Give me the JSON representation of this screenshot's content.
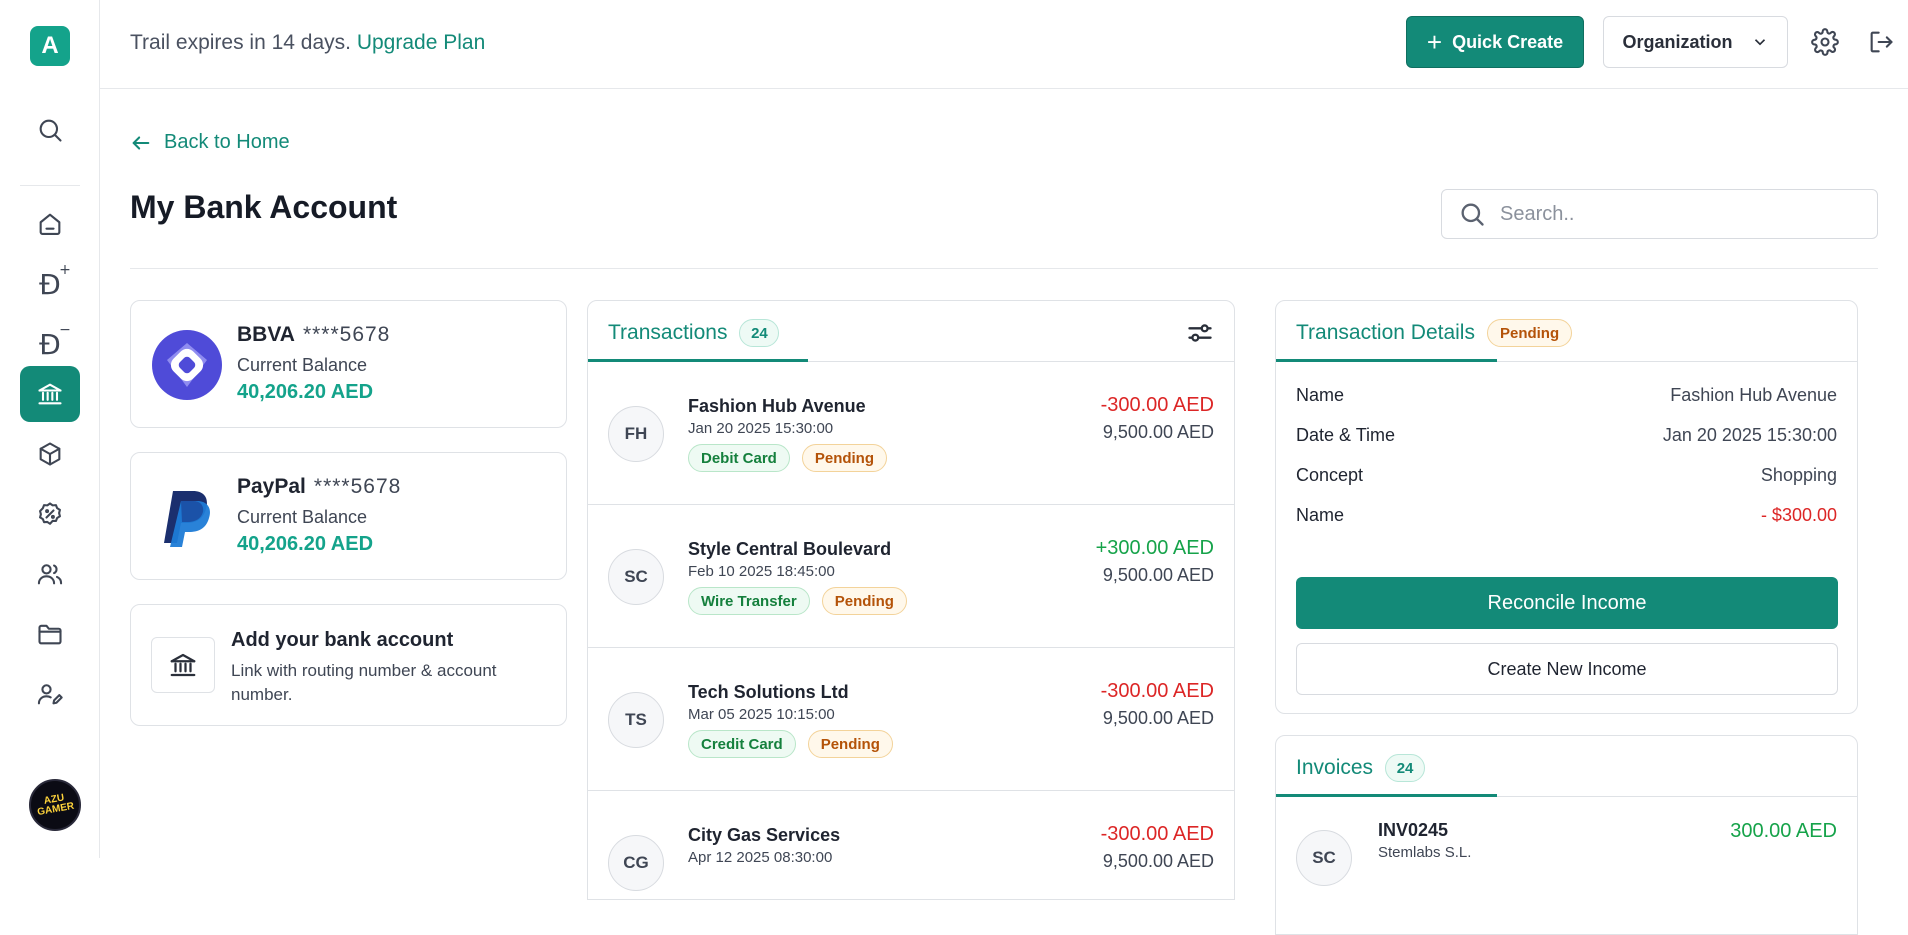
{
  "app": {
    "logo_letter": "A"
  },
  "header": {
    "trial_text": "Trail expires in 14 days.",
    "upgrade_link": "Upgrade Plan",
    "quick_create": "Quick Create",
    "organization": "Organization"
  },
  "sidebar": {
    "items": [
      {
        "icon": "search-icon",
        "active": false
      },
      {
        "icon": "home-icon",
        "active": false
      },
      {
        "icon": "dirham-plus-icon",
        "active": false
      },
      {
        "icon": "dirham-minus-icon",
        "active": false
      },
      {
        "icon": "bank-icon",
        "active": true
      },
      {
        "icon": "box-icon",
        "active": false
      },
      {
        "icon": "discount-icon",
        "active": false
      },
      {
        "icon": "users-icon",
        "active": false
      },
      {
        "icon": "folder-icon",
        "active": false
      },
      {
        "icon": "user-edit-icon",
        "active": false
      }
    ],
    "avatar_text": "AZU GAMER"
  },
  "page": {
    "back_label": "Back to Home",
    "title": "My Bank Account",
    "search_placeholder": "Search.."
  },
  "accounts": [
    {
      "name": "BBVA",
      "mask": "****5678",
      "label": "Current Balance",
      "balance": "40,206.20 AED",
      "logo": "bbva-logo"
    },
    {
      "name": "PayPal",
      "mask": "****5678",
      "label": "Current Balance",
      "balance": "40,206.20 AED",
      "logo": "paypal-logo"
    }
  ],
  "add_account": {
    "title": "Add your bank account",
    "description": "Link with routing number & account number."
  },
  "transactions": {
    "tab_label": "Transactions",
    "count": "24",
    "items": [
      {
        "initials": "FH",
        "name": "Fashion Hub Avenue",
        "date": "Jan 20 2025 15:30:00",
        "method": "Debit Card",
        "status": "Pending",
        "amount": "-300.00 AED",
        "direction": "neg",
        "balance": "9,500.00 AED"
      },
      {
        "initials": "SC",
        "name": "Style Central Boulevard",
        "date": "Feb 10 2025 18:45:00",
        "method": "Wire Transfer",
        "status": "Pending",
        "amount": "+300.00 AED",
        "direction": "pos",
        "balance": "9,500.00 AED"
      },
      {
        "initials": "TS",
        "name": "Tech Solutions Ltd",
        "date": "Mar 05 2025 10:15:00",
        "method": "Credit Card",
        "status": "Pending",
        "amount": "-300.00 AED",
        "direction": "neg",
        "balance": "9,500.00 AED"
      },
      {
        "initials": "CG",
        "name": "City Gas Services",
        "date": "Apr 12 2025 08:30:00",
        "method": "",
        "status": "",
        "amount": "-300.00 AED",
        "direction": "neg",
        "balance": "9,500.00 AED"
      }
    ]
  },
  "details": {
    "tab_label": "Transaction Details",
    "status": "Pending",
    "rows": [
      {
        "key": "Name",
        "value": "Fashion Hub Avenue"
      },
      {
        "key": "Date & Time",
        "value": "Jan 20 2025 15:30:00"
      },
      {
        "key": "Concept",
        "value": "Shopping"
      },
      {
        "key": "Name",
        "value": "- $300.00"
      }
    ],
    "reconcile_label": "Reconcile Income",
    "create_label": "Create New Income"
  },
  "invoices": {
    "tab_label": "Invoices",
    "count": "24",
    "items": [
      {
        "initials": "SC",
        "id": "INV0245",
        "company": "Stemlabs S.L.",
        "amount": "300.00 AED"
      }
    ]
  },
  "colors": {
    "accent": "#138a78",
    "brand_green": "#14a38b",
    "negative": "#dc2626",
    "positive": "#16a34a",
    "pending": "#b45309"
  }
}
